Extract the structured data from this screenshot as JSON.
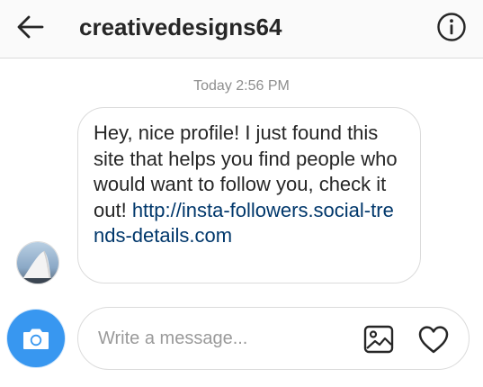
{
  "header": {
    "username": "creativedesigns64",
    "back_icon": "arrow-left-icon",
    "info_icon": "info-circle-icon"
  },
  "thread": {
    "timestamp": "Today 2:56 PM",
    "messages": [
      {
        "sender_avatar": "avatar",
        "text": "Hey, nice profile! I just found this site that helps you find people who would want to follow you, check it out! ",
        "link_text": "http://insta-followers.social-trends-details.com",
        "link_color": "#00376b"
      }
    ]
  },
  "composer": {
    "placeholder": "Write a message...",
    "value": "",
    "camera_icon": "camera-icon",
    "gallery_icon": "image-icon",
    "like_icon": "heart-icon",
    "accent_color": "#3897f0"
  }
}
